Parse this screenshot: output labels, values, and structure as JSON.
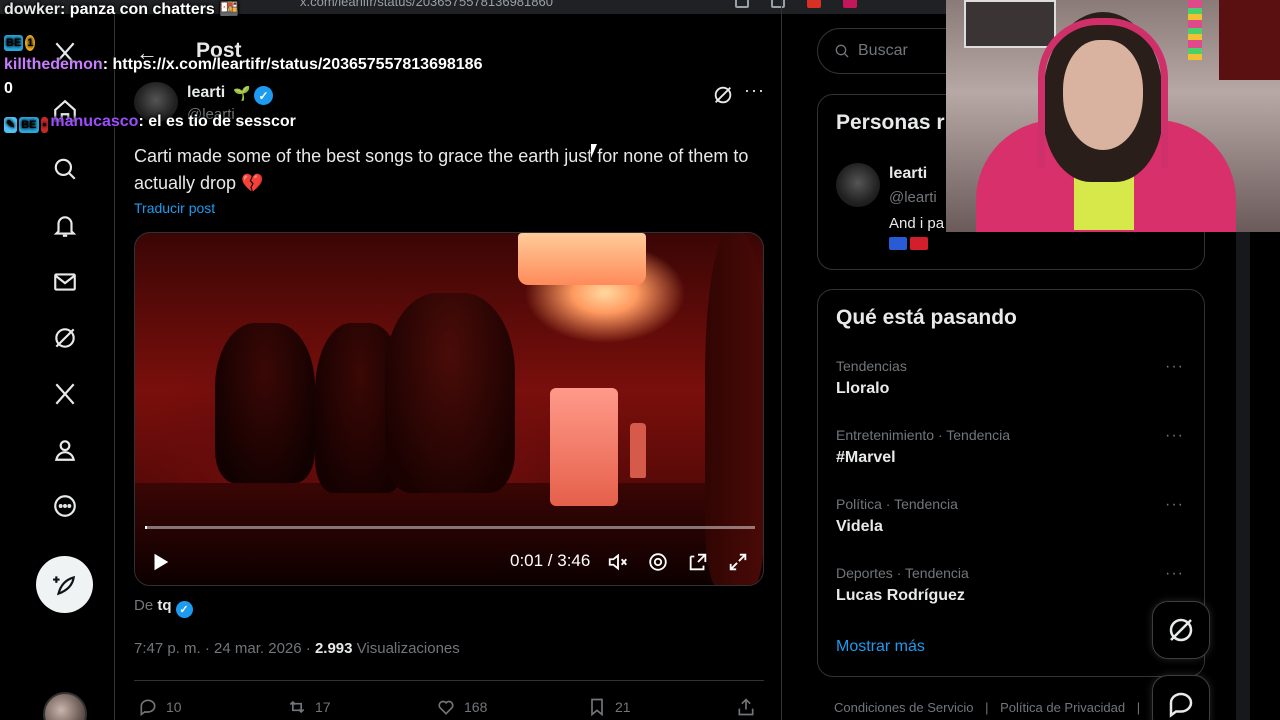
{
  "browser": {
    "url": "x.com/learlifr/status/2036575578136981860"
  },
  "chat": [
    {
      "user": "dowker",
      "message": "panza con chatters 🍱"
    },
    {
      "user": "killthedemon",
      "message": "https://x.com/leartifr/status/203657557813698186"
    },
    {
      "user": "",
      "message": "0"
    },
    {
      "user": "manucasco",
      "message": "el es tio de sesscor"
    }
  ],
  "header": {
    "back_icon": "arrow-left-icon",
    "title": "Post"
  },
  "post": {
    "author_name": "learti",
    "author_emoji": "🌱",
    "handle": "@learti",
    "text": "Carti made some of the best songs to grace the earth just for none of them to actually drop 💔",
    "translate": "Traducir post",
    "video": {
      "time": "0:01 / 3:46",
      "progress": 0.004
    },
    "source_prefix": "De",
    "source_name": "tq",
    "time_date": "7:47 p. m. · 24 mar. 2026 ·",
    "views": "2.993",
    "views_label": "Visualizaciones",
    "replies": "10",
    "reposts": "17",
    "likes": "168",
    "bookmarks": "21"
  },
  "search": {
    "placeholder": "Buscar"
  },
  "people": {
    "title": "Personas r",
    "name": "learti",
    "handle": "@learti",
    "bio": "And i pa"
  },
  "trends": {
    "title": "Qué está pasando",
    "items": [
      {
        "category": "Tendencias",
        "name": "Lloralo"
      },
      {
        "category": "Entretenimiento · Tendencia",
        "name": "#Marvel"
      },
      {
        "category": "Política · Tendencia",
        "name": "Videla"
      },
      {
        "category": "Deportes · Tendencia",
        "name": "Lucas Rodríguez"
      }
    ],
    "show_more": "Mostrar más"
  },
  "footer": {
    "terms": "Condiciones de Servicio",
    "sep": "|",
    "privacy": "Política de Privacidad",
    "sep2": "|"
  },
  "colors": {
    "accent": "#1d9bf0",
    "background": "#000000",
    "border": "#2f3336",
    "muted": "#71767b"
  }
}
